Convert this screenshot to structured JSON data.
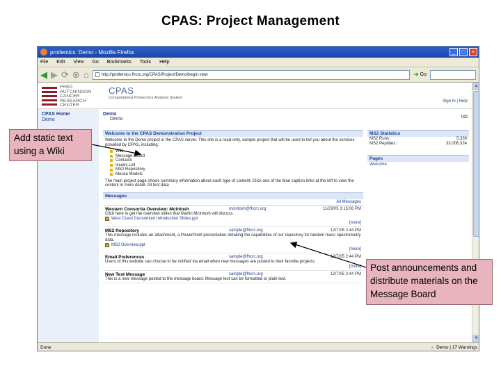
{
  "slide": {
    "title": "CPAS: Project Management"
  },
  "browser": {
    "window_title": "protlemics: Demo - Mozilla Firefox",
    "menu": [
      "File",
      "Edit",
      "View",
      "Go",
      "Bookmarks",
      "Tools",
      "Help"
    ],
    "url": "http://protlemics.fhcrc.org/CPAS/Project/Demo/begin.view",
    "go_label": "Go",
    "status_text": "Done",
    "status_right": "Demo | 17 Warnings"
  },
  "cpas": {
    "org_lines": [
      "FRED",
      "HUTCHINSON",
      "CANCER",
      "RESEARCH",
      "CENTER"
    ],
    "app_name": "CPAS",
    "app_subtitle": "Computational Proteomics Analysis System",
    "sign_in": "Sign In | Help",
    "nav": {
      "home": "CPAS Home",
      "item": "Demo"
    },
    "breadcrumb": "Demo",
    "breadcrumb_sub": "Demo",
    "right_label": "lsb",
    "wiki": {
      "title": "Welcome to the CPAS Demonstration Project",
      "intro": "Welcome to the Demo project in the CPAS server. This site is a read-only, sample project that will be used to tell you about the services provided by CPAS, including:",
      "items": [
        "Wiki",
        "Message Board",
        "Contacts",
        "Issues List",
        "MS2 Repository",
        "Mouse Models"
      ],
      "outro": "The main project page shows summary information about each type of content. Click one of the blue caption links at the left to view the content in more detail. All test data"
    },
    "messages": {
      "title": "Messages",
      "all_link": "All Messages",
      "items": [
        {
          "title": "Western Consortia Overview: McIntosh",
          "author": "mcintosh@fhcrc.org",
          "date": "11/29/05 3:15:06 PM",
          "body": "Click here to get the overview slides that Martin McIntosh will discuss.",
          "attachment": "West Coast Consortium Introduction Slides.ppt",
          "more": "[more]"
        },
        {
          "title": "MS2 Repository",
          "author": "sample@fhcrc.org",
          "date": "12/7/05 2:44 PM",
          "body": "This message includes an attachment, a PowerPoint presentation detailing the capabilities of our repository for tandem mass spectrometry data.",
          "attachment": "MS2 Overview.ppt",
          "more": "[more]"
        },
        {
          "title": "Email Preferences",
          "author": "sample@fhcrc.org",
          "date": "12/7/05 2:44 PM",
          "body": "Users of this website can choose to be notified via email when new messages are posted to their favorite projects.",
          "attachment": "",
          "more": "[more]"
        },
        {
          "title": "New Test Message",
          "author": "sample@fhcrc.org",
          "date": "12/7/05 2:44 PM",
          "body": "This is a new message posted to the message board. Message text can be formatted or plain text.",
          "attachment": "",
          "more": ""
        }
      ]
    },
    "stats": {
      "title": "MS2 Statistics",
      "rows": [
        {
          "k": "MS2 Runs:",
          "v": "5,330"
        },
        {
          "k": "MS2 Peptides:",
          "v": "33,006,324"
        }
      ]
    },
    "pages": {
      "title": "Pages",
      "link": "Welcome"
    }
  },
  "callouts": {
    "wiki": "Add static text using a Wiki",
    "board": "Post announcements and distribute materials on the Message Board"
  }
}
